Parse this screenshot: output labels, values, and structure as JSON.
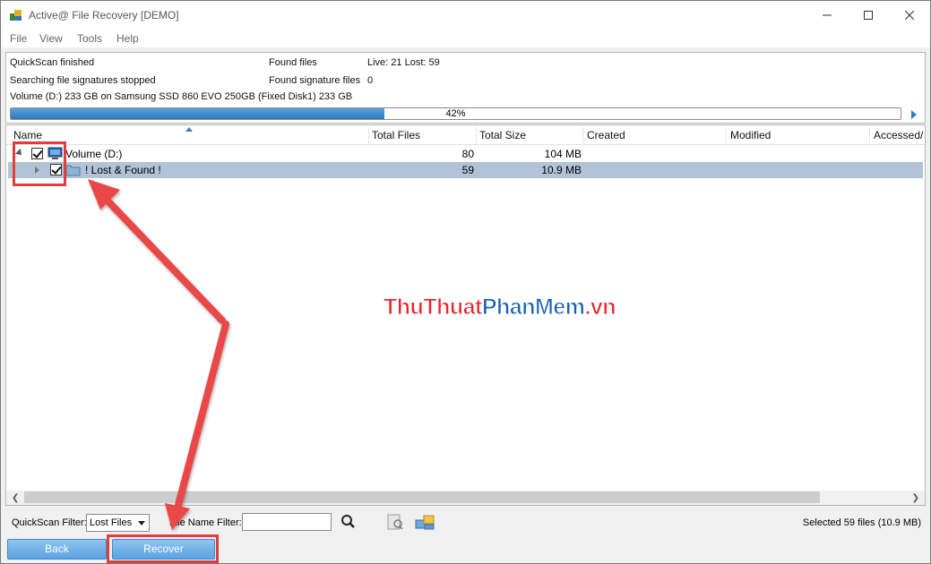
{
  "window": {
    "title": "Active@ File Recovery [DEMO]"
  },
  "menu": [
    "File",
    "View",
    "Tools",
    "Help"
  ],
  "status": {
    "scan_state": "QuickScan finished",
    "signature_state": "Searching file signatures stopped",
    "volume_info": "Volume (D:) 233 GB on Samsung SSD 860 EVO 250GB (Fixed Disk1) 233 GB",
    "found_files_label": "Found files",
    "found_files_value": "Live: 21 Lost: 59",
    "found_sig_label": "Found signature files",
    "found_sig_value": "0",
    "progress_text": "42%",
    "progress_fraction": 0.42
  },
  "columns": [
    "Name",
    "Total Files",
    "Total Size",
    "Created",
    "Modified",
    "Accessed/"
  ],
  "rows": [
    {
      "name": "Volume (D:)",
      "total_files": "80",
      "total_size": "104 MB"
    },
    {
      "name": "! Lost & Found !",
      "total_files": "59",
      "total_size": "10.9 MB"
    }
  ],
  "filter": {
    "quickscan_label": "QuickScan Filter:",
    "quickscan_value": "Lost Files",
    "filename_label": "File Name Filter:",
    "filename_value": "",
    "selected_text": "Selected 59 files (10.9 MB)"
  },
  "buttons": {
    "back": "Back",
    "recover": "Recover"
  },
  "watermark": {
    "part1": "ThuThuat",
    "part2": "PhanMem",
    "part3": ".vn"
  },
  "colors": {
    "progress": "#2f78c0",
    "selection": "#b2c3d8",
    "annotation": "#e23c3c",
    "button": "#5aa3e3"
  }
}
